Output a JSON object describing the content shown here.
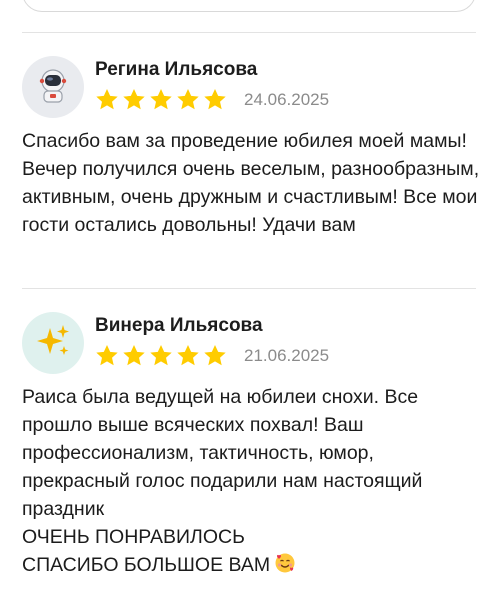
{
  "reviews": [
    {
      "author": "Регина Ильясова",
      "avatar_icon": "astronaut-icon",
      "rating": 5,
      "date": "24.06.2025",
      "text": "Спасибо вам за проведение юбилея моей мамы! Вечер получился очень веселым, разнообразным, активным, очень дружным и счастливым! Все мои гости остались довольны! Удачи вам"
    },
    {
      "author": "Винера Ильясова",
      "avatar_icon": "sparkles-icon",
      "rating": 5,
      "date": "21.06.2025",
      "text": "Раиса была ведущей на юбилеи снохи. Все прошло выше всяческих похвал! Ваш профессионализм, тактичность, юмор, прекрасный голос подарили нам настоящий праздник\nОЧЕНЬ ПОНРАВИЛОСЬ\nСПАСИБО БОЛЬШОЕ ВАМ"
    }
  ],
  "colors": {
    "star": "#ffcc00",
    "date": "#8b8b8b",
    "divider": "#e3e3e3"
  }
}
